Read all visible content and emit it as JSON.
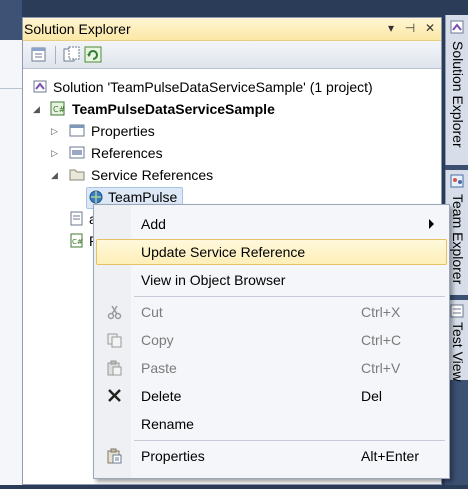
{
  "panel": {
    "title": "Solution Explorer",
    "pin_label": "▾",
    "autohide_label": "⊣",
    "close_label": "✕"
  },
  "tree": {
    "solution": "Solution 'TeamPulseDataServiceSample' (1 project)",
    "project": "TeamPulseDataServiceSample",
    "properties": "Properties",
    "references": "References",
    "service_references": "Service References",
    "teampulse": "TeamPulse",
    "partial_item_1": "a",
    "partial_item_2": "P"
  },
  "dock_tabs": [
    {
      "label": "Solution Explorer"
    },
    {
      "label": "Team Explorer"
    },
    {
      "label": "Test View"
    }
  ],
  "context_menu": {
    "items": [
      {
        "label": "Add",
        "shortcut": "",
        "has_submenu": true,
        "disabled": false,
        "icon": ""
      },
      {
        "label": "Update Service Reference",
        "shortcut": "",
        "highlighted": true,
        "disabled": false,
        "icon": ""
      },
      {
        "label": "View in Object Browser",
        "shortcut": "",
        "disabled": false,
        "icon": ""
      },
      {
        "label": "Cut",
        "shortcut": "Ctrl+X",
        "disabled": true,
        "icon": "scissors-icon"
      },
      {
        "label": "Copy",
        "shortcut": "Ctrl+C",
        "disabled": true,
        "icon": "copy-icon"
      },
      {
        "label": "Paste",
        "shortcut": "Ctrl+V",
        "disabled": true,
        "icon": "paste-icon"
      },
      {
        "label": "Delete",
        "shortcut": "Del",
        "disabled": false,
        "icon": "delete-x-icon"
      },
      {
        "label": "Rename",
        "shortcut": "",
        "disabled": false,
        "icon": ""
      },
      {
        "label": "Properties",
        "shortcut": "Alt+Enter",
        "disabled": false,
        "icon": "properties-icon"
      }
    ]
  },
  "colors": {
    "highlight": "#fdefb8",
    "title_bar": "#fbe8a6",
    "ide_background": "#2b3c59"
  }
}
